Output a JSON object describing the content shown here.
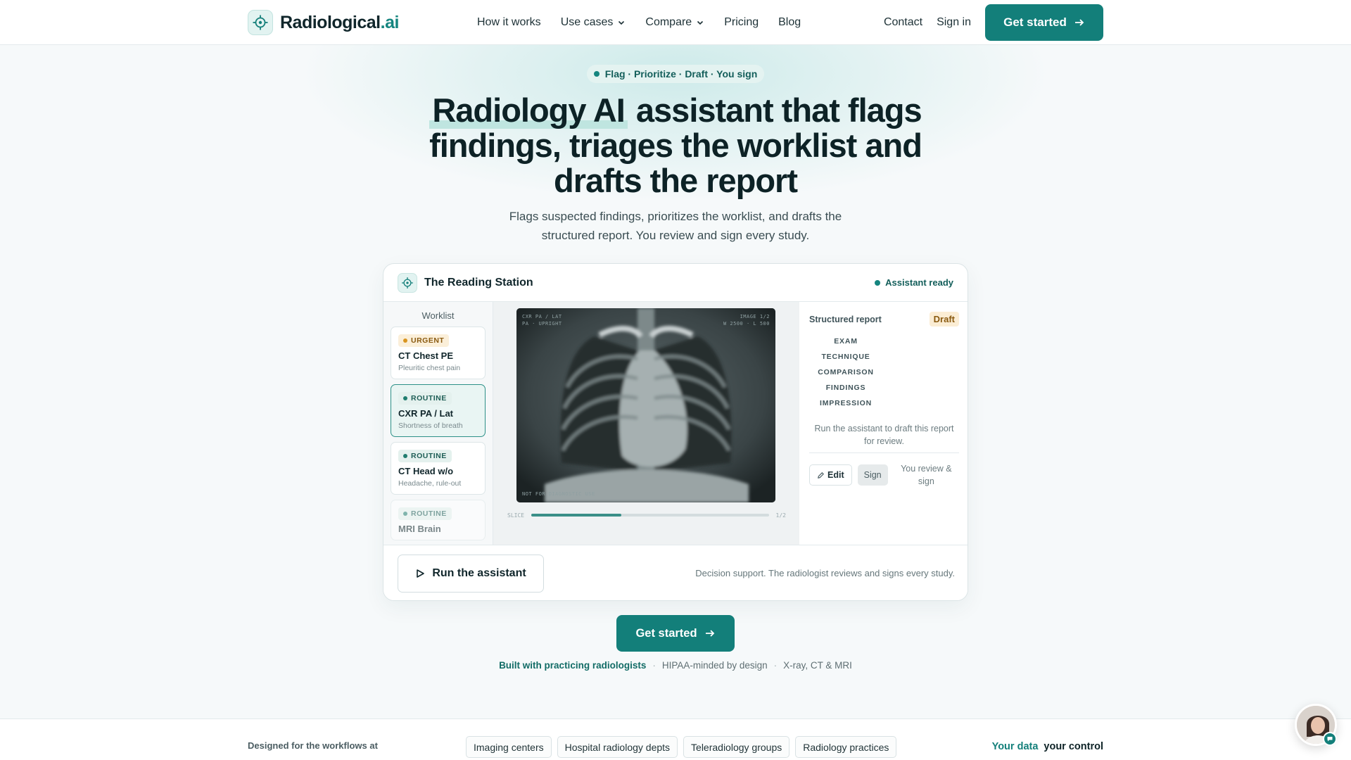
{
  "brand": {
    "name": "Radiological",
    "tld": ".ai"
  },
  "nav": {
    "links": [
      {
        "label": "How it works"
      },
      {
        "label": "Use cases"
      },
      {
        "label": "Compare"
      },
      {
        "label": "Pricing"
      },
      {
        "label": "Blog"
      }
    ],
    "contact": "Contact",
    "sign_in": "Sign in",
    "cta": "Get started"
  },
  "hero": {
    "eyebrow": "Flag · Prioritize · Draft · You sign",
    "headline_highlight": "Radiology AI",
    "headline_rest": " assistant that flags findings, triages the worklist and drafts the report",
    "subhead": "Flags suspected findings, prioritizes the worklist, and drafts the structured report. You review and sign every study.",
    "cta": "Get started"
  },
  "station": {
    "title": "The Reading Station",
    "status": "Assistant ready",
    "worklist_title": "Worklist",
    "worklist": [
      {
        "tag": "URGENT",
        "name": "CT Chest PE",
        "sub": "Pleuritic chest pain"
      },
      {
        "tag": "ROUTINE",
        "name": "CXR PA / Lat",
        "sub": "Shortness of breath"
      },
      {
        "tag": "ROUTINE",
        "name": "CT Head w/o",
        "sub": "Headache, rule-out"
      },
      {
        "tag": "ROUTINE",
        "name": "MRI Brain",
        "sub": ""
      }
    ],
    "viewer": {
      "top_left_1": "CXR PA / LAT",
      "top_left_2": "PA · UPRIGHT",
      "top_right_1": "IMAGE 1/2",
      "top_right_2": "W 2500 · L 500",
      "bottom_left": "NOT FOR DIAGNOSTIC USE",
      "slice_label": "SLICE",
      "slice_value": "1/2",
      "slice_progress": 0.38
    },
    "report": {
      "title": "Structured report",
      "badge": "Draft",
      "sections": [
        "EXAM",
        "TECHNIQUE",
        "COMPARISON",
        "FINDINGS",
        "IMPRESSION"
      ],
      "note": "Run the assistant to draft this report for review.",
      "edit": "Edit",
      "sign": "Sign",
      "review_note": "You review & sign"
    },
    "run_button": "Run the assistant",
    "footer_note": "Decision support. The radiologist reviews and signs every study."
  },
  "trust": {
    "lead": "Built with practicing radiologists",
    "items": [
      "HIPAA-minded by design",
      "X-ray, CT & MRI"
    ]
  },
  "band": {
    "lead": "Designed for the workflows at",
    "chips": [
      "Imaging centers",
      "Hospital radiology depts",
      "Teleradiology groups",
      "Radiology practices"
    ],
    "right_accent": "Your data",
    "right_rest": "your control"
  },
  "colors": {
    "accent": "#137f7a",
    "urgent": "#d9951f",
    "routine": "#1f7d6f"
  }
}
